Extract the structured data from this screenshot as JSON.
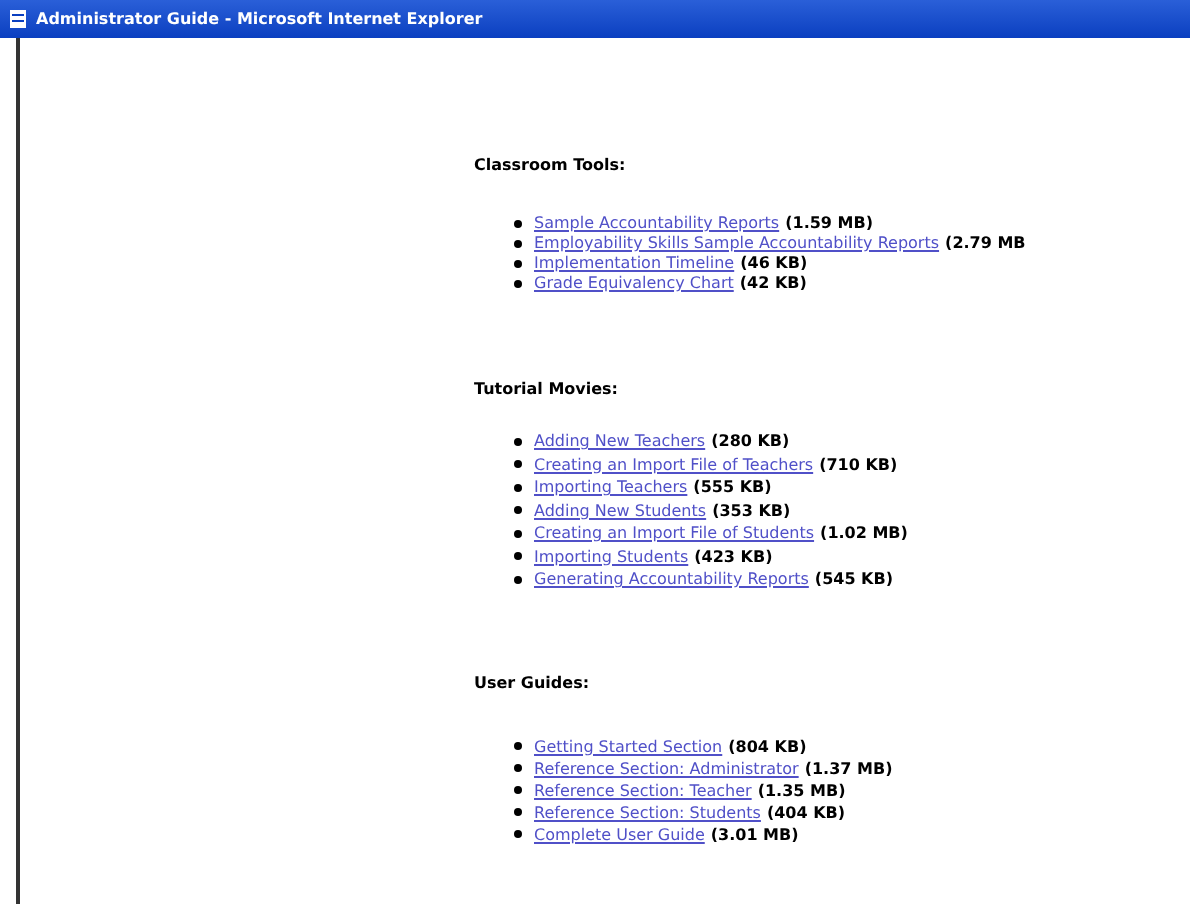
{
  "window": {
    "title": "Administrator Guide - Microsoft Internet Explorer"
  },
  "sections": [
    {
      "heading": "Classroom Tools:",
      "items": [
        {
          "link": "Sample Accountability Reports",
          "size": "(1.59 MB)"
        },
        {
          "link": "Employability Skills Sample Accountability Reports",
          "size": "(2.79 MB"
        },
        {
          "link": "Implementation Timeline",
          "size": "(46 KB)"
        },
        {
          "link": "Grade Equivalency Chart",
          "size": "(42 KB)"
        }
      ]
    },
    {
      "heading": "Tutorial Movies:",
      "items": [
        {
          "link": "Adding New Teachers",
          "size": "(280 KB)"
        },
        {
          "link": "Creating an Import File of Teachers",
          "size": "(710 KB)"
        },
        {
          "link": "Importing Teachers",
          "size": "(555 KB)"
        },
        {
          "link": "Adding New Students",
          "size": "(353 KB)"
        },
        {
          "link": "Creating an Import File of Students",
          "size": "(1.02 MB)"
        },
        {
          "link": "Importing Students",
          "size": "(423 KB)"
        },
        {
          "link": "Generating Accountability Reports",
          "size": "(545 KB)"
        }
      ]
    },
    {
      "heading": "User Guides:",
      "items": [
        {
          "link": "Getting Started Section",
          "size": "(804 KB)"
        },
        {
          "link": "Reference Section: Administrator",
          "size": "(1.37 MB)"
        },
        {
          "link": "Reference Section: Teacher",
          "size": "(1.35 MB)"
        },
        {
          "link": "Reference Section: Students",
          "size": "(404 KB)"
        },
        {
          "link": "Complete User Guide",
          "size": "(3.01 MB)"
        }
      ]
    }
  ]
}
